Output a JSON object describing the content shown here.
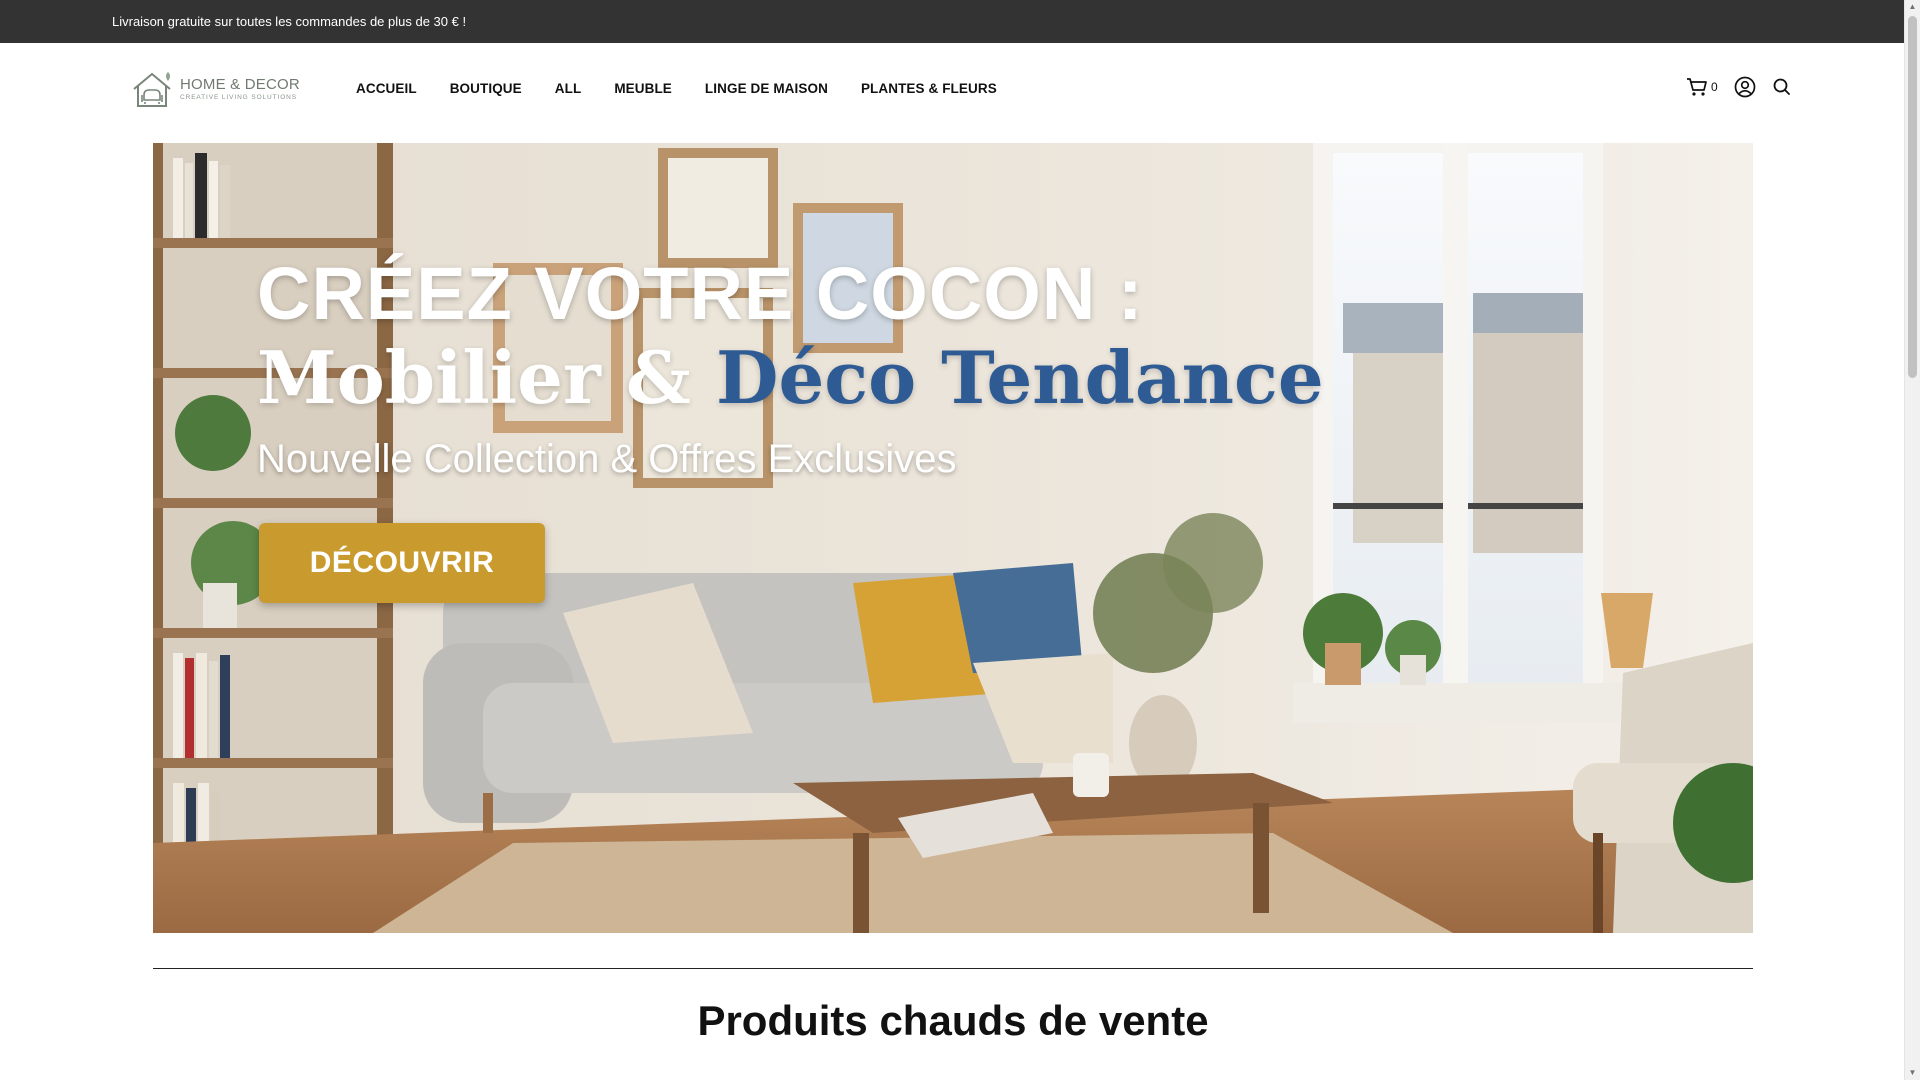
{
  "announcement": {
    "text": "Livraison gratuite sur toutes les commandes de plus de 30 € !"
  },
  "logo": {
    "name": "HOME & DECOR",
    "tagline": "CREATIVE LIVING SOLUTIONS"
  },
  "nav": {
    "items": [
      {
        "label": "ACCUEIL"
      },
      {
        "label": "BOUTIQUE"
      },
      {
        "label": "ALL"
      },
      {
        "label": "MEUBLE"
      },
      {
        "label": "LINGE DE MAISON"
      },
      {
        "label": "PLANTES & FLEURS"
      }
    ]
  },
  "header_icons": {
    "cart_icon": "shopping-cart-icon",
    "cart_count": "0",
    "account_icon": "user-circle-icon",
    "search_icon": "search-icon"
  },
  "hero": {
    "line1": "CRÉEZ VOTRE COCON :",
    "line2_part1": "Mobilier & ",
    "line2_part2": "Déco Tendance",
    "line3": "Nouvelle Collection & Offres Exclusives",
    "cta_label": "DÉCOUVRIR",
    "colors": {
      "cta": "#c99b2f",
      "accent_text": "#2f5b94"
    }
  },
  "section": {
    "title": "Produits chauds de vente"
  },
  "colors": {
    "announcement_bg": "#333333",
    "text_dark": "#111111"
  }
}
